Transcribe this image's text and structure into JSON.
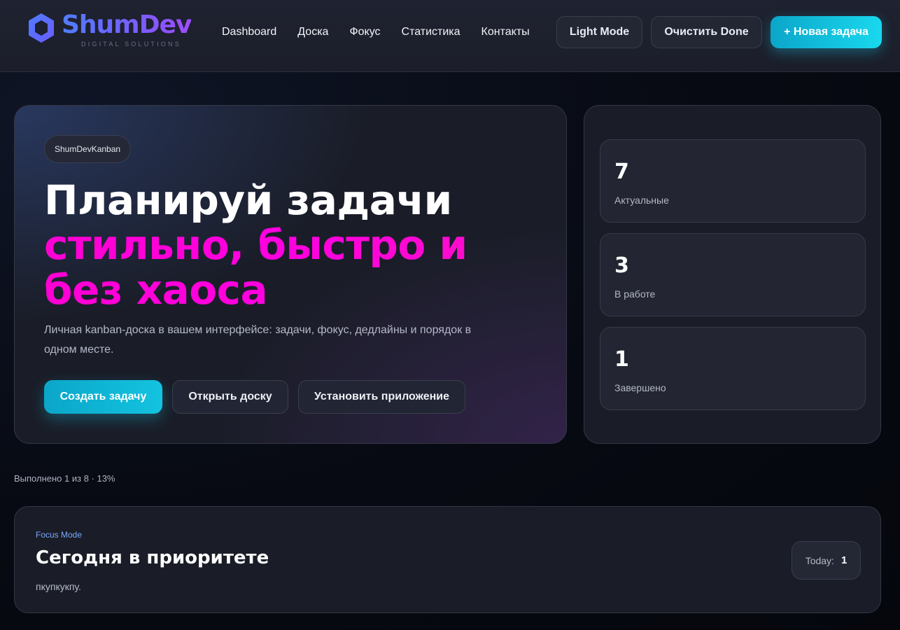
{
  "header": {
    "logo_name": "ShumDev",
    "logo_tagline": "DIGITAL SOLUTIONS",
    "nav": [
      "Dashboard",
      "Доска",
      "Фокус",
      "Статистика",
      "Контакты"
    ],
    "light_mode_label": "Light Mode",
    "clear_done_label": "Очистить Done",
    "new_task_label": "+ Новая задача"
  },
  "hero": {
    "chip": "ShumDevKanban",
    "title_line1": "Планируй задачи",
    "title_accent": "стильно, быстро и без хаоса",
    "description": "Личная kanban-доска в вашем интерфейсе: задачи, фокус, дедлайны и порядок в одном месте.",
    "actions": {
      "create": "Создать задачу",
      "open": "Открыть доску",
      "install": "Установить приложение"
    }
  },
  "stats": [
    {
      "value": "7",
      "label": "Актуальные"
    },
    {
      "value": "3",
      "label": "В работе"
    },
    {
      "value": "1",
      "label": "Завершено"
    }
  ],
  "progress_text": "Выполнено 1 из 8 · 13%",
  "focus": {
    "eyebrow": "Focus Mode",
    "title": "Сегодня в приоритете",
    "text": "пкупкукпу.",
    "today_label": "Today:",
    "today_value": "1"
  },
  "colors": {
    "accent_cyan": "#13c3e0",
    "accent_magenta": "#ff00d4",
    "brand_blue": "#4f7dff",
    "brand_purple": "#a04dff"
  }
}
